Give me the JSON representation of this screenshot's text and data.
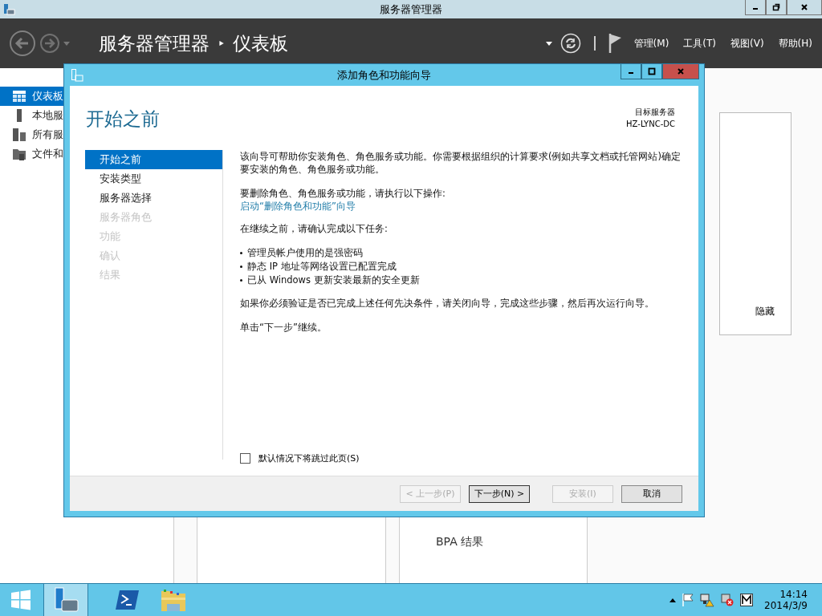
{
  "window": {
    "title": "服务器管理器"
  },
  "header": {
    "breadcrumb": [
      "服务器管理器",
      "仪表板"
    ],
    "separator": "‣",
    "menus": [
      "管理(M)",
      "工具(T)",
      "视图(V)",
      "帮助(H)"
    ]
  },
  "sidebar": {
    "items": [
      {
        "label": "仪表板",
        "selected": true
      },
      {
        "label": "本地服",
        "selected": false
      },
      {
        "label": "所有服",
        "selected": false
      },
      {
        "label": "文件和",
        "selected": false
      }
    ]
  },
  "background": {
    "hide_link": "隐藏",
    "tile_item": "BPA 结果"
  },
  "dialog": {
    "title": "添加角色和功能向导",
    "heading": "开始之前",
    "target_label": "目标服务器",
    "target_server": "HZ-LYNC-DC",
    "steps": [
      {
        "label": "开始之前",
        "selected": true,
        "disabled": false
      },
      {
        "label": "安装类型",
        "selected": false,
        "disabled": false
      },
      {
        "label": "服务器选择",
        "selected": false,
        "disabled": false
      },
      {
        "label": "服务器角色",
        "selected": false,
        "disabled": true
      },
      {
        "label": "功能",
        "selected": false,
        "disabled": true
      },
      {
        "label": "确认",
        "selected": false,
        "disabled": true
      },
      {
        "label": "结果",
        "selected": false,
        "disabled": true
      }
    ],
    "content": [
      {
        "kind": "text",
        "text": "该向导可帮助你安装角色、角色服务或功能。你需要根据组织的计算要求(例如共享文档或托管网站)确定要安装的角色、角色服务或功能。"
      },
      {
        "kind": "text",
        "text": "要删除角色、角色服务或功能，请执行以下操作:"
      },
      {
        "kind": "link",
        "text": "启动“删除角色和功能”向导"
      },
      {
        "kind": "text",
        "text": "在继续之前，请确认完成以下任务:"
      },
      {
        "kind": "bullets",
        "items": [
          "管理员帐户使用的是强密码",
          "静态 IP 地址等网络设置已配置完成",
          "已从 Windows 更新安装最新的安全更新"
        ]
      },
      {
        "kind": "text",
        "text": "如果你必须验证是否已完成上述任何先决条件，请关闭向导，完成这些步骤，然后再次运行向导。"
      },
      {
        "kind": "text",
        "text": "单击“下一步”继续。"
      }
    ],
    "skip_checkbox": {
      "label": "默认情况下将跳过此页(S)",
      "checked": false
    },
    "buttons": [
      {
        "label": "< 上一步(P)",
        "disabled": true,
        "default": false
      },
      {
        "label": "下一步(N) >",
        "disabled": false,
        "default": true
      },
      {
        "label": "安装(I)",
        "disabled": true,
        "default": false
      },
      {
        "label": "取消",
        "disabled": false,
        "default": false
      }
    ]
  },
  "taskbar": {
    "time": "14:14",
    "date": "2014/3/9"
  }
}
